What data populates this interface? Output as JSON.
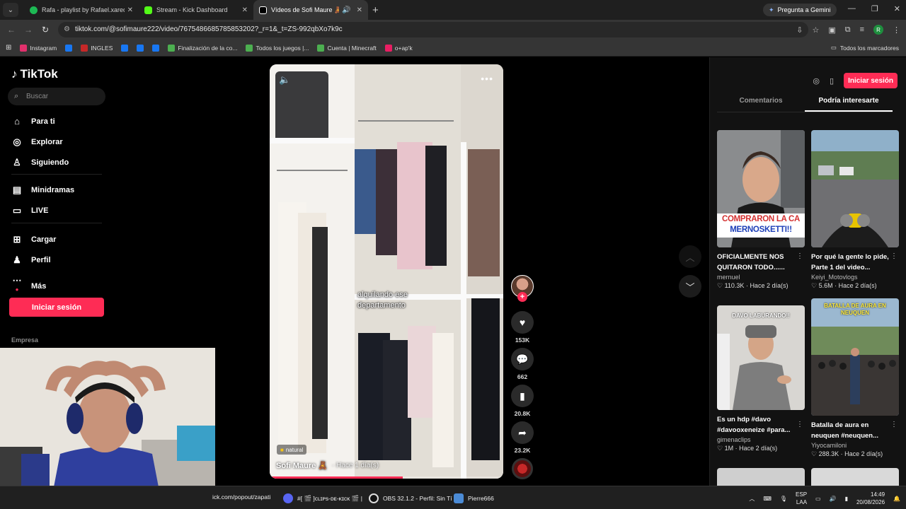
{
  "browser": {
    "tabs": [
      {
        "title": "Rafa - playlist by Rafael.xared |",
        "icon": "spotify-icon",
        "color": "#1db954"
      },
      {
        "title": "Stream - Kick Dashboard",
        "icon": "kick-icon",
        "color": "#53fc18"
      },
      {
        "title": "Vídeos de Sofi Maure 🧸 (",
        "icon": "tiktok-icon",
        "color": "#ffffff",
        "active": true
      }
    ],
    "gemini_label": "Pregunta a Gemini",
    "url": "tiktok.com/@sofimaure222/video/7675486685785853202?_r=1&_t=ZS-992qbXo7k9c",
    "profile_initial": "R",
    "bookmarks": [
      {
        "label": "Instagram",
        "color": "#e1306c"
      },
      {
        "label": "",
        "color": "#1877f2"
      },
      {
        "label": "INGLES",
        "color": "#c62828"
      },
      {
        "label": "",
        "color": "#1877f2"
      },
      {
        "label": "",
        "color": "#1877f2"
      },
      {
        "label": "",
        "color": "#1877f2"
      },
      {
        "label": "Finalización de la co...",
        "color": "#4caf50"
      },
      {
        "label": "Todos los juegos |...",
        "color": "#4caf50"
      },
      {
        "label": "Cuenta | Minecraft",
        "color": "#4caf50"
      },
      {
        "label": "o+ap'k",
        "color": "#e91e63"
      }
    ],
    "all_bookmarks": "Todos los marcadores"
  },
  "sidebar": {
    "logo": "TikTok",
    "search_placeholder": "Buscar",
    "items": [
      {
        "label": "Para ti",
        "icon": "home-icon"
      },
      {
        "label": "Explorar",
        "icon": "compass-icon"
      },
      {
        "label": "Siguiendo",
        "icon": "following-icon"
      },
      {
        "label": "Minidramas",
        "icon": "film-icon"
      },
      {
        "label": "LIVE",
        "icon": "live-icon"
      },
      {
        "label": "Cargar",
        "icon": "upload-icon"
      },
      {
        "label": "Perfil",
        "icon": "profile-icon"
      },
      {
        "label": "Más",
        "icon": "more-icon"
      }
    ],
    "login": "Iniciar sesión",
    "company": "Empresa"
  },
  "video": {
    "caption_line1": "alquilando ese",
    "caption_line2": "departamento",
    "tag": "natural",
    "username": "Sofi Maure 🧸",
    "time": "· Hace 1 día(s)",
    "progress": 0.57,
    "likes": "153K",
    "comments": "662",
    "saves": "20.8K",
    "shares": "23.2K"
  },
  "right_panel": {
    "login": "Iniciar sesión",
    "tabs": [
      "Comentarios",
      "Podría interesarte"
    ],
    "cards": [
      {
        "title": "OFICIALMENTE NOS QUITARON TODO......",
        "author": "mernuel",
        "views": "110.3K",
        "time": "Hace 2 día(s)",
        "thumb_text": "COMPRARON LA CA MERNOSKETTI!!"
      },
      {
        "title": "Por qué la gente lo pide, Parte 1 del video...",
        "author": "Keiyi_Motovlogs",
        "views": "5.6M",
        "time": "Hace 2 día(s)",
        "thumb_text": ""
      },
      {
        "title": "Es un hdp #davo #davooxeneize #para...",
        "author": "gimenaclips",
        "views": "1M",
        "time": "Hace 2 día(s)",
        "thumb_text": "DAVO LABURANDO!!"
      },
      {
        "title": "Batalla de aura en neuquen #neuquen...",
        "author": "Yiyocamiloni",
        "views": "288.3K",
        "time": "Hace 2 día(s)",
        "thumb_text": "BATALLA DE AURA EN NEUQUEN"
      }
    ]
  },
  "taskbar": {
    "items": [
      {
        "label": "ick.com/popout/zapati"
      },
      {
        "label": "#[ 🎬 ]ᴄʟɪᴘs-ᴅᴇ-ᴋɪᴄᴋ 🎬 |"
      },
      {
        "label": "OBS 32.1.2 - Perfil: Sin Tí"
      },
      {
        "label": "Pierre666"
      }
    ],
    "lang": "ESP",
    "lang2": "LAA",
    "time": "14:49",
    "date": "20/08/2026"
  }
}
